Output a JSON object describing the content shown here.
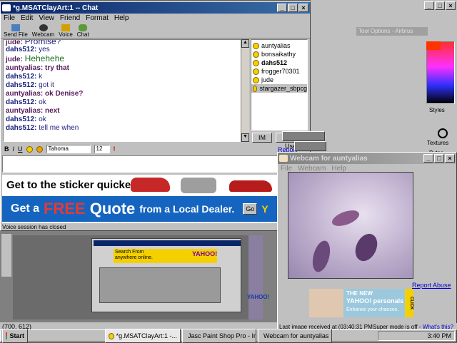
{
  "chat": {
    "title": "*g.MSATClayArt:1 -- Chat",
    "menu": [
      "File",
      "Edit",
      "View",
      "Friend",
      "Format",
      "Help"
    ],
    "toolbar": [
      "Send File",
      "Webcam",
      "Voice",
      "Chat"
    ],
    "messages": [
      {
        "nick": "jude:",
        "text": "Promise?"
      },
      {
        "nick": "dahs512:",
        "text": "yes"
      },
      {
        "nick": "jude:",
        "text": "Hehehehe"
      },
      {
        "nick": "auntyalias:",
        "text": "try that"
      },
      {
        "nick": "dahs512:",
        "text": "k"
      },
      {
        "nick": "dahs512:",
        "text": "got it"
      },
      {
        "nick": "auntyalias:",
        "text": "ok Denise?"
      },
      {
        "nick": "dahs512:",
        "text": "ok"
      },
      {
        "nick": "auntyalias:",
        "text": "next"
      },
      {
        "nick": "dahs512:",
        "text": "ok"
      },
      {
        "nick": "dahs512:",
        "text": "tell me when"
      }
    ],
    "buddies": [
      "auntyalias",
      "bonsaikathy",
      "dahs512",
      "frogger70301",
      "jude",
      "stargazer_sbpcg"
    ],
    "im_label": "IM",
    "ignore_label": "Ignore User",
    "report_abuse": "Report Abuse",
    "format": {
      "bold": "B",
      "italic": "I",
      "underline": "U",
      "font": "Tahoma",
      "size": "12"
    },
    "ad": {
      "headline": "Get to the sticker quicker.",
      "line_pre": "Get a",
      "line_free": "FREE",
      "line_quote": "Quote",
      "line_post": "from a Local Dealer.",
      "go": "Go",
      "brand": "Y"
    },
    "status": "Voice session has closed"
  },
  "webcam": {
    "title": "Webcam for auntyalias",
    "menu": [
      "File",
      "Webcam",
      "Help"
    ],
    "report_abuse": "Report Abuse",
    "ad_line1": "THE NEW",
    "ad_line2": "YAHOO! personals",
    "ad_line3": "Enhance your chances.",
    "ad_click": "CLICK",
    "status": "Last image received at (03:40:31 PM)",
    "super_mode": "Super mode is off -",
    "whats_this": "What's this?"
  },
  "background": {
    "tool_options": "Tool Options - Airbrus",
    "styles": "Styles",
    "textures": "Textures",
    "bytes": "Bytes",
    "coords": "(700, 612)",
    "yahoo": "YAHOO!",
    "search_from": "Search From",
    "anywhere_online": "anywhere online."
  },
  "taskbar": {
    "start": "Start",
    "items": [
      "*g.MSATClayArt:1 -...",
      "Jasc Paint Shop Pro - Ima...",
      "Webcam for auntyalias"
    ],
    "time": "3:40 PM"
  },
  "colors": {
    "title_active": "#0a246a",
    "title_inactive": "#808080",
    "ad_blue": "#1565c0",
    "ad_red": "#e53935"
  }
}
